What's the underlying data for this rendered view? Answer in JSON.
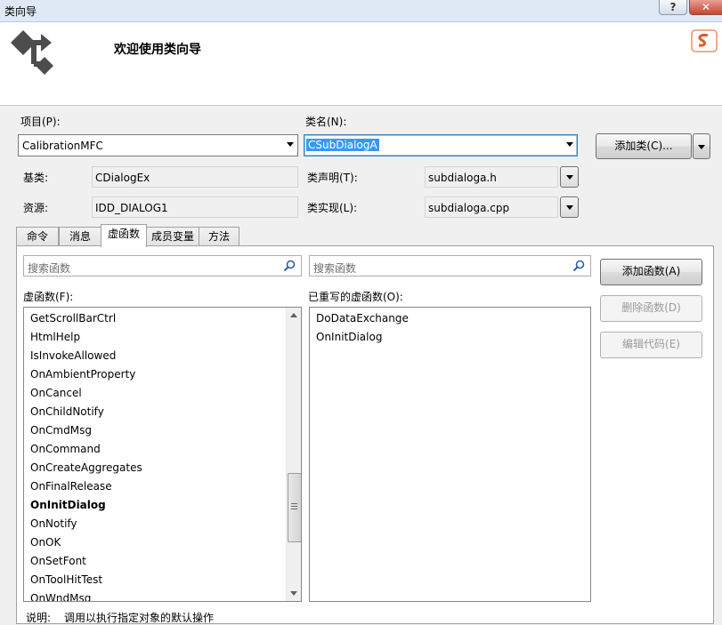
{
  "window": {
    "title": "类向导",
    "help_label": "?",
    "close_label": "✕"
  },
  "header": {
    "welcome": "欢迎使用类向导"
  },
  "form": {
    "project_label": "项目(P):",
    "project_value": "CalibrationMFC",
    "classname_label": "类名(N):",
    "classname_value": "CSubDialogA",
    "add_class_label": "添加类(C)...",
    "base_label": "基类:",
    "base_value": "CDialogEx",
    "decl_label": "类声明(T):",
    "decl_value": "subdialoga.h",
    "resource_label": "资源:",
    "resource_value": "IDD_DIALOG1",
    "impl_label": "类实现(L):",
    "impl_value": "subdialoga.cpp"
  },
  "tabs": [
    "命令",
    "消息",
    "虚函数",
    "成员变量",
    "方法"
  ],
  "active_tab": "虚函数",
  "virtual": {
    "search_placeholder": "搜索函数",
    "list_label": "虚函数(F):",
    "items": [
      "GetScrollBarCtrl",
      "HtmlHelp",
      "IsInvokeAllowed",
      "OnAmbientProperty",
      "OnCancel",
      "OnChildNotify",
      "OnCmdMsg",
      "OnCommand",
      "OnCreateAggregates",
      "OnFinalRelease",
      "OnInitDialog",
      "OnNotify",
      "OnOK",
      "OnSetFont",
      "OnToolHitTest",
      "OnWndMsg"
    ],
    "bold_item": "OnInitDialog"
  },
  "overridden": {
    "search_placeholder": "搜索函数",
    "list_label": "已重写的虚函数(O):",
    "items": [
      "DoDataExchange",
      "OnInitDialog"
    ]
  },
  "buttons": {
    "add_function": "添加函数(A)",
    "delete_function": "删除函数(D)",
    "edit_code": "编辑代码(E)"
  },
  "description": {
    "label": "说明:",
    "text": "调用以执行指定对象的默认操作"
  },
  "colors": {
    "selection": "#3399ff",
    "titlebar": "#dfe9f5",
    "dialog_bg": "#f0f0f0"
  },
  "icons": [
    "class-wizard-logo-icon",
    "search-icon",
    "ime-logo-icon"
  ]
}
